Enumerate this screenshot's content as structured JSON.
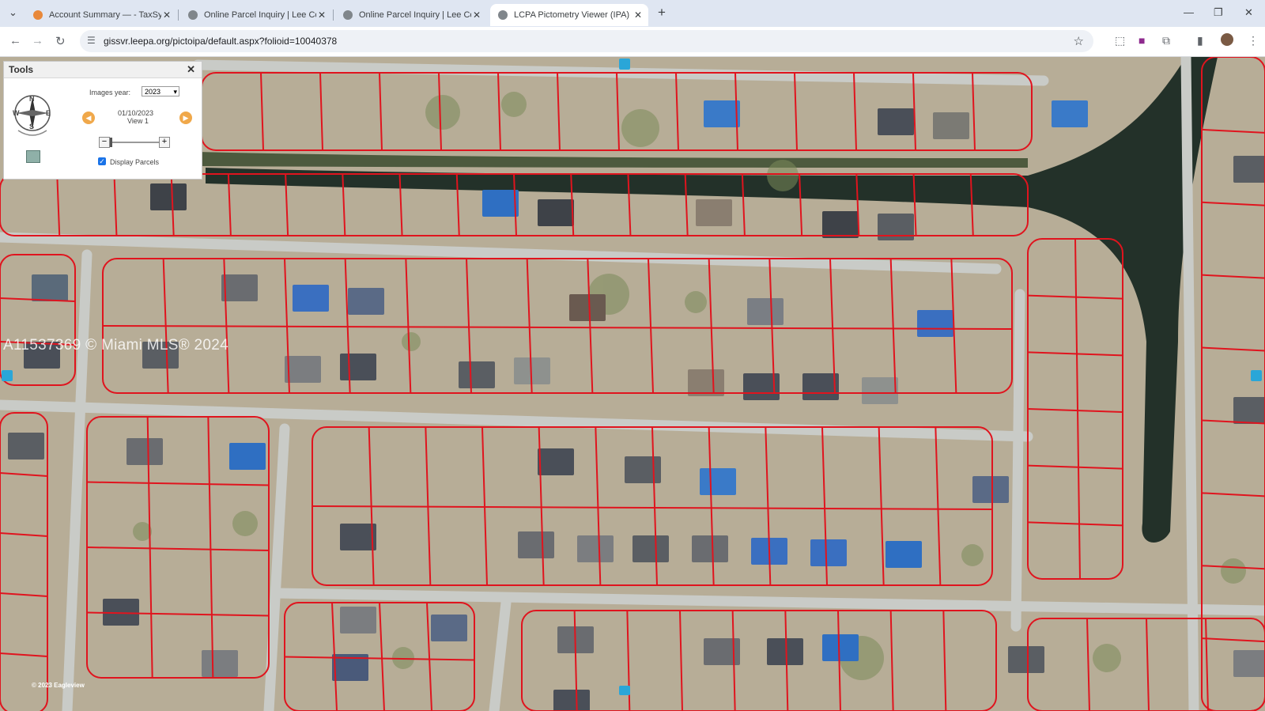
{
  "browser": {
    "tabs": [
      {
        "title": "Account Summary — - TaxSys -",
        "favicon_color": "#e8883a",
        "active": false
      },
      {
        "title": "Online Parcel Inquiry | Lee Cour",
        "favicon_color": "#5f6368",
        "active": false
      },
      {
        "title": "Online Parcel Inquiry | Lee Cour",
        "favicon_color": "#5f6368",
        "active": false
      },
      {
        "title": "LCPA Pictometry Viewer (IPA)",
        "favicon_color": "#5f6368",
        "active": true
      }
    ],
    "url": "gissvr.leepa.org/pictoipa/default.aspx?folioid=10040378"
  },
  "tools_panel": {
    "title": "Tools",
    "images_year_label": "Images year:",
    "images_year_value": "2023",
    "image_date": "01/10/2023",
    "view_label": "View 1",
    "display_parcels_label": "Display Parcels",
    "display_parcels_checked": true,
    "compass_letters": [
      "N",
      "E",
      "S",
      "W"
    ]
  },
  "map": {
    "watermark": "A11537369 © Miami MLS® 2024",
    "copyright": "© 2023 Eagleview",
    "parcel_line_color": "#e0141e"
  }
}
